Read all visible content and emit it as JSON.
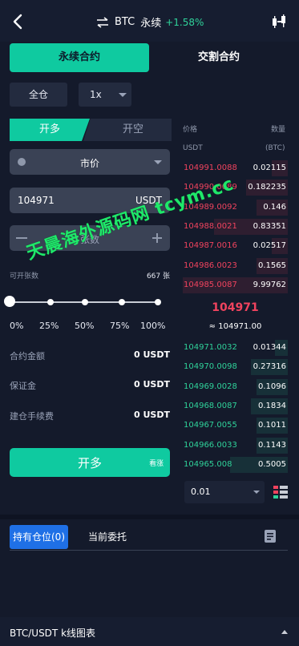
{
  "header": {
    "symbol": "BTC",
    "contract_type": "永续",
    "change": "+1.58%"
  },
  "contract_tabs": [
    "永续合约",
    "交割合约"
  ],
  "margin_mode": "全仓",
  "leverage": "1x",
  "side_tabs": {
    "long": "开多",
    "short": "开空"
  },
  "order_type": "市价",
  "price_input": {
    "value": "104971",
    "unit": "USDT"
  },
  "qty_input": {
    "placeholder": "张数"
  },
  "available": {
    "label": "可开张数",
    "value": "667 张"
  },
  "slider": {
    "labels": [
      "0%",
      "25%",
      "50%",
      "75%",
      "100%"
    ],
    "value_pct": 0
  },
  "info": [
    {
      "label": "合约金额",
      "value": "0 USDT"
    },
    {
      "label": "保证金",
      "value": "0 USDT"
    },
    {
      "label": "建仓手续费",
      "value": "0 USDT"
    }
  ],
  "action_button": {
    "label": "开多",
    "sub": "看涨"
  },
  "orderbook": {
    "price_header": "价格",
    "qty_header": "数量",
    "price_unit": "USDT",
    "qty_unit": "(BTC)",
    "asks": [
      {
        "price": "104991.0088",
        "qty": "0.02115",
        "depth": 0.15
      },
      {
        "price": "104990.0089",
        "qty": "0.182235",
        "depth": 0.4
      },
      {
        "price": "104989.0092",
        "qty": "0.146",
        "depth": 0.3
      },
      {
        "price": "104988.0021",
        "qty": "0.83351",
        "depth": 0.7
      },
      {
        "price": "104987.0016",
        "qty": "0.02517",
        "depth": 0.15
      },
      {
        "price": "104986.0023",
        "qty": "0.1565",
        "depth": 0.3
      },
      {
        "price": "104985.0087",
        "qty": "9.99762",
        "depth": 1.0
      }
    ],
    "mid_price": "104971",
    "mark_price": "≈ 104971.00",
    "bids": [
      {
        "price": "104971.0032",
        "qty": "0.01344",
        "depth": 0.12
      },
      {
        "price": "104970.0098",
        "qty": "0.27316",
        "depth": 0.35
      },
      {
        "price": "104969.0028",
        "qty": "0.1096",
        "depth": 0.3
      },
      {
        "price": "104968.0087",
        "qty": "0.1834",
        "depth": 0.35
      },
      {
        "price": "104967.0055",
        "qty": "0.1011",
        "depth": 0.3
      },
      {
        "price": "104966.0033",
        "qty": "0.1143",
        "depth": 0.3
      },
      {
        "price": "104965.008",
        "qty": "0.5005",
        "depth": 0.55
      }
    ],
    "precision": "0.01"
  },
  "position_tabs": [
    "持有仓位(0)",
    "当前委托"
  ],
  "footer": {
    "label": "BTC/USDT  k线图表"
  },
  "watermark": "天晨海外源码网 tcym.cc",
  "colors": {
    "accent": "#0fcaa0",
    "ask": "#f0435e",
    "bid": "#2fd29a",
    "tab_active": "#1f70e6",
    "background": "#141a2b"
  }
}
